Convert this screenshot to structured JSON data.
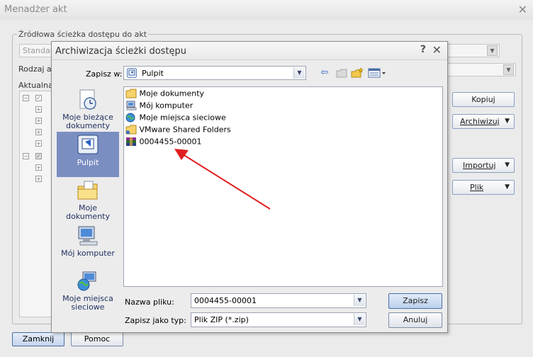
{
  "background_window": {
    "title": "Menadżer akt",
    "group_label": "Źródłowa ścieżka dostępu do akt",
    "source_combo_value": "Standard",
    "type_label": "Rodzaj ak",
    "current_label": "Aktualna",
    "buttons": {
      "copy": "Kopiuj",
      "archive": "Archiwizuj",
      "import": "Importuj",
      "file": "Plik"
    },
    "close_button": "Zamknij",
    "help_button": "Pomoc"
  },
  "dialog": {
    "title": "Archiwizacja ścieżki dostępu",
    "help_glyph": "?",
    "close_glyph": "✕",
    "save_in_label": "Zapisz w:",
    "save_in_value": "Pulpit",
    "places": [
      {
        "label": "Moje bieżące dokumenty",
        "icon": "recent-documents-icon",
        "selected": false
      },
      {
        "label": "Pulpit",
        "icon": "desktop-icon",
        "selected": true
      },
      {
        "label": "Moje dokumenty",
        "icon": "my-documents-icon",
        "selected": false
      },
      {
        "label": "Mój komputer",
        "icon": "my-computer-icon",
        "selected": false
      },
      {
        "label": "Moje miejsca sieciowe",
        "icon": "network-places-icon",
        "selected": false
      }
    ],
    "files": [
      {
        "name": "Moje dokumenty",
        "icon": "folder-icon"
      },
      {
        "name": "Mój komputer",
        "icon": "computer-icon"
      },
      {
        "name": "Moje miejsca sieciowe",
        "icon": "network-icon"
      },
      {
        "name": "VMware Shared Folders",
        "icon": "shared-folder-icon"
      },
      {
        "name": "0004455-00001",
        "icon": "zip-archive-icon"
      }
    ],
    "file_name_label": "Nazwa pliku:",
    "file_name_value": "0004455-00001",
    "file_type_label": "Zapisz jako typ:",
    "file_type_value": "Plik ZIP (*.zip)",
    "save_button": "Zapisz",
    "cancel_button": "Anuluj"
  },
  "colors": {
    "selection": "#7b8ec2",
    "annotation_arrow": "#e02020"
  }
}
